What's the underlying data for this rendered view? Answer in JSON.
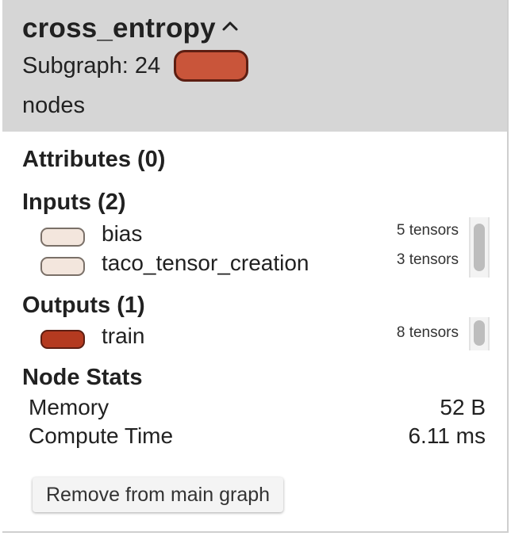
{
  "header": {
    "title": "cross_entropy",
    "subgraph_text": "Subgraph: 24",
    "nodes_text": "nodes",
    "subgraph_color": "#c9553a"
  },
  "attributes": {
    "title": "Attributes (0)"
  },
  "inputs": {
    "title": "Inputs (2)",
    "items": [
      {
        "name": "bias",
        "count": "5 tensors",
        "color": "#f3e6dd"
      },
      {
        "name": "taco_tensor_creation",
        "count": "3 tensors",
        "color": "#f3e6dd"
      }
    ]
  },
  "outputs": {
    "title": "Outputs (1)",
    "items": [
      {
        "name": "train",
        "count": "8 tensors",
        "color": "#b43a20"
      }
    ]
  },
  "node_stats": {
    "title": "Node Stats",
    "rows": [
      {
        "key": "Memory",
        "value": "52 B"
      },
      {
        "key": "Compute Time",
        "value": "6.11 ms"
      }
    ]
  },
  "actions": {
    "remove_label": "Remove from main graph"
  }
}
